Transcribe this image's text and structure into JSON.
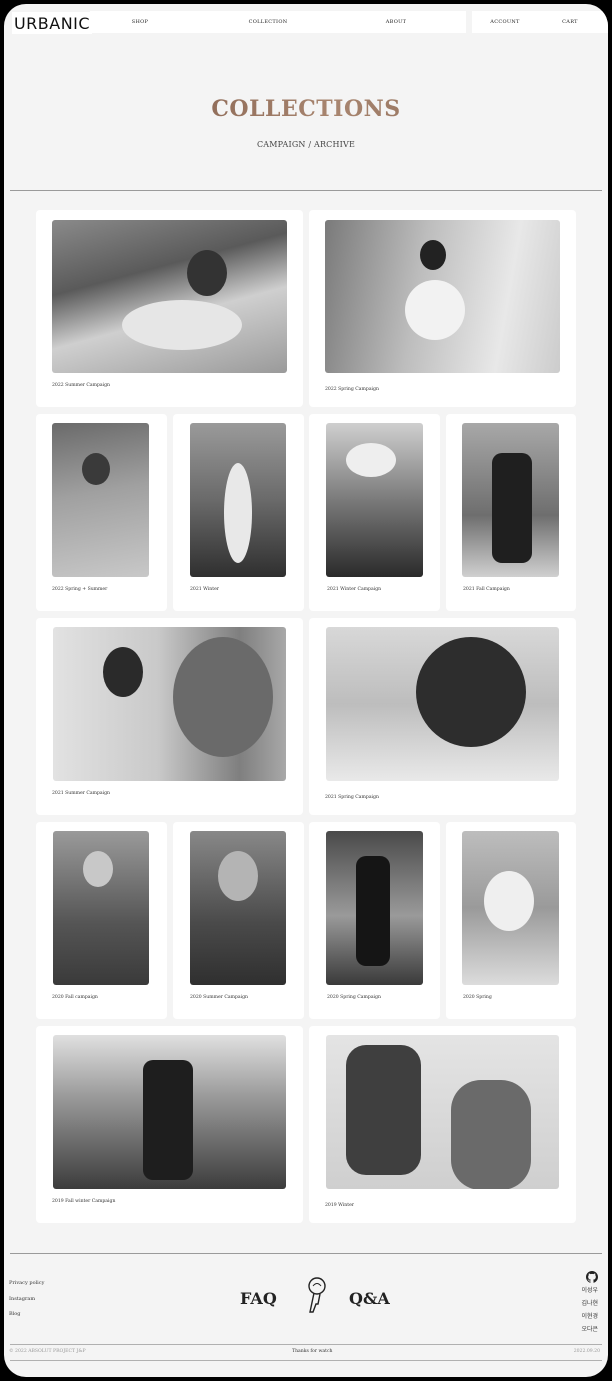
{
  "header": {
    "logo": "URBANIC",
    "nav": [
      "SHOP",
      "COLLECTION",
      "ABOUT"
    ],
    "account": "ACCOUNT",
    "cart": "CART"
  },
  "hero": {
    "title": "COLLECTIONS",
    "subtitle": "CAMPAIGN / ARCHIVE"
  },
  "collections": [
    "2022 Summer Campaign",
    "2022 Spring Campaign",
    "2022 Spring + Summer",
    "2021 Winter",
    "2021 Winter Campaign",
    "2021 Fall Campaign",
    "2021 Summer Campaign",
    "2021 Spring Campaign",
    "2020 Fall campaign",
    "2020 Summer Campaign",
    "2020 Spring Campaign",
    "2020 Spring",
    "2019 Fall winter Campaign",
    "2019 Winter"
  ],
  "footer": {
    "links": [
      "Privacy policy",
      "Instagram",
      "Blog"
    ],
    "faq": "FAQ",
    "qa": "Q&A",
    "github_icon": "github-icon",
    "key_icon": "key-icon",
    "members": [
      "이성우",
      "김나현",
      "이현경",
      "오다은"
    ],
    "copyright": "© 2022 ABSOLUT PROJECT J&P",
    "thanks": "Thanks for watch",
    "date": "2022.09.20"
  }
}
